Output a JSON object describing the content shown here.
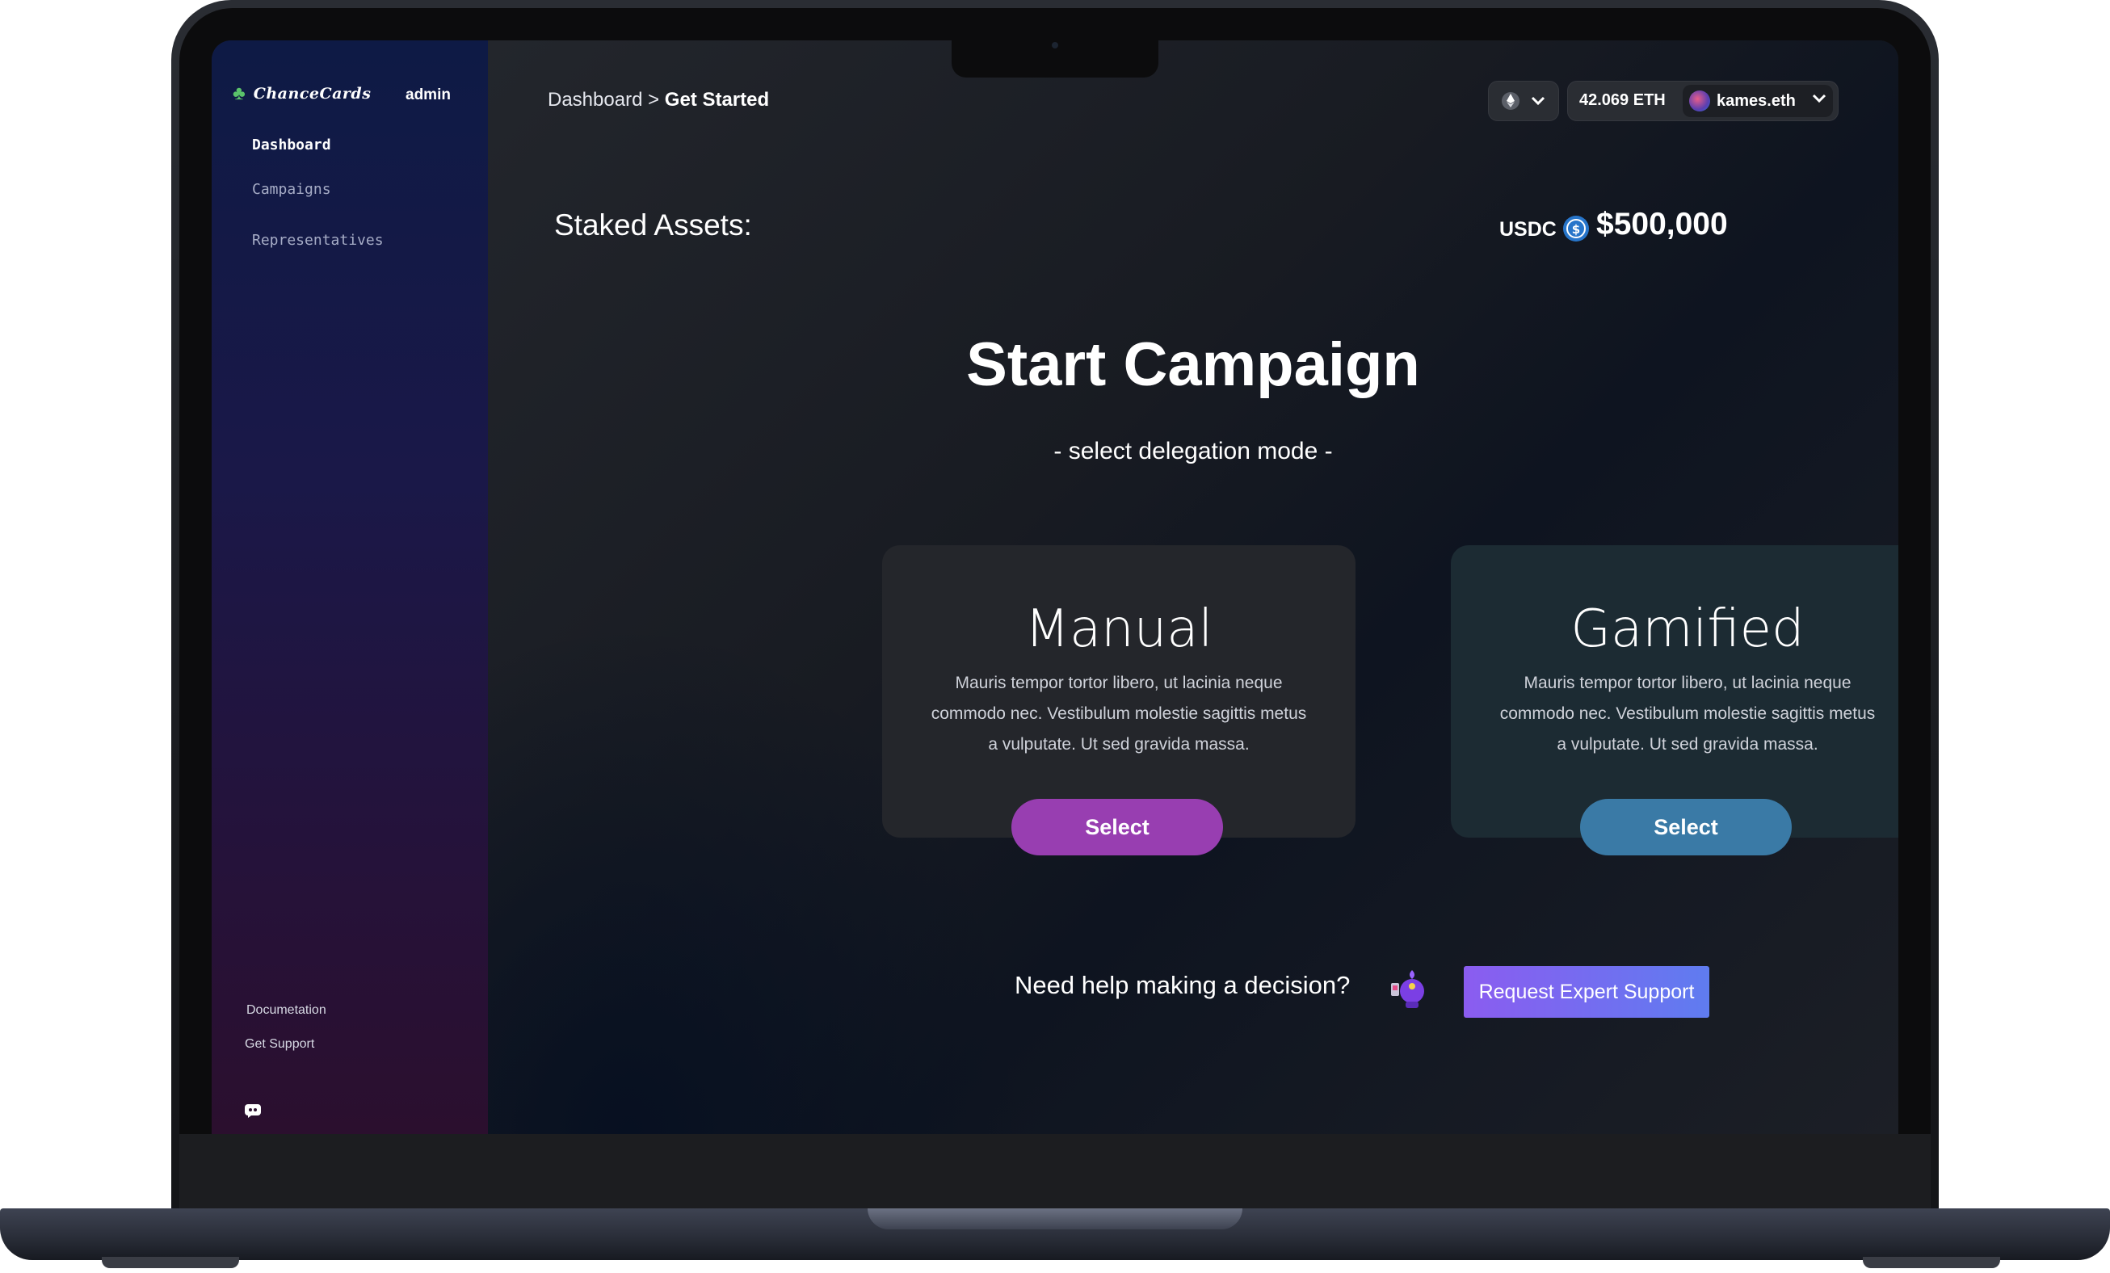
{
  "sidebar": {
    "brand": "ChanceCards",
    "role": "admin",
    "nav": [
      {
        "label": "Dashboard",
        "active": true
      },
      {
        "label": "Campaigns",
        "active": false
      },
      {
        "label": "Representatives",
        "active": false
      }
    ],
    "footer_links": [
      {
        "label": "Documetation"
      },
      {
        "label": "Get Support"
      }
    ],
    "social_icon": "discord-icon"
  },
  "header": {
    "breadcrumb": {
      "parent": "Dashboard",
      "separator": ">",
      "current": "Get Started"
    },
    "network_icon": "ethereum-icon",
    "balance": "42.069 ETH",
    "account": "kames.eth"
  },
  "staked": {
    "label": "Staked Assets:",
    "token": "USDC",
    "amount": "$500,000"
  },
  "hero": {
    "title": "Start Campaign",
    "subtitle": "- select delegation mode -"
  },
  "modes": [
    {
      "title": "Manual",
      "description": "Mauris tempor tortor libero, ut lacinia neque commodo nec. Vestibulum molestie sagittis metus a vulputate. Ut sed gravida massa.",
      "button": "Select",
      "color": "#983eb1"
    },
    {
      "title": "Gamified",
      "description": "Mauris tempor tortor libero, ut lacinia neque commodo nec. Vestibulum molestie sagittis metus a vulputate. Ut sed gravida massa.",
      "button": "Select",
      "color": "#3a7aa6"
    }
  ],
  "help": {
    "prompt": "Need help making a decision?",
    "button": "Request Expert Support"
  },
  "colors": {
    "accent_purple": "#983eb1",
    "accent_blue": "#3a7aa6",
    "expert_gradient_start": "#8b5cf0",
    "expert_gradient_end": "#5f7cf0"
  }
}
